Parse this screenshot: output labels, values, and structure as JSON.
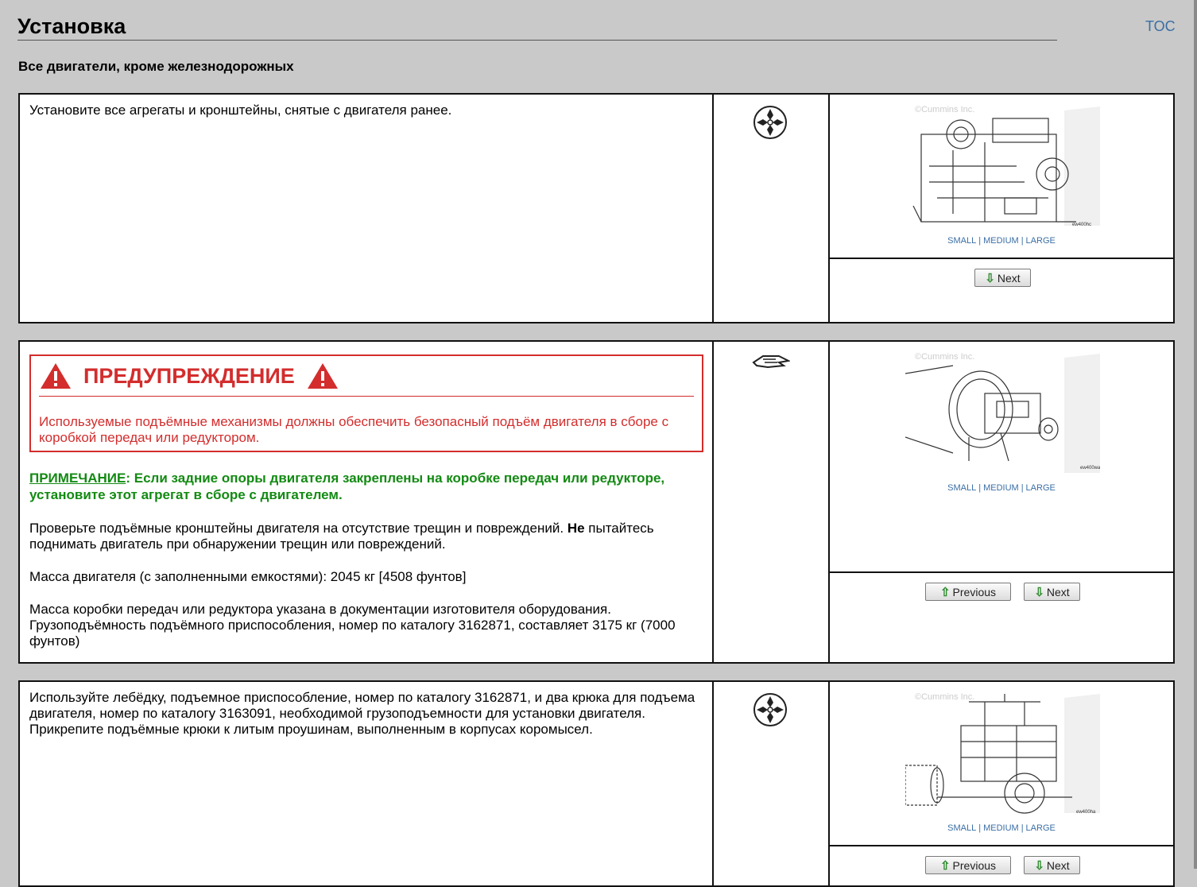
{
  "header": {
    "title": "Установка",
    "toc_label": "TOC",
    "subtitle": "Все двигатели, кроме железнодорожных"
  },
  "image_sizes": {
    "small": "SMALL",
    "medium": "MEDIUM",
    "large": "LARGE",
    "separator": "|"
  },
  "buttons": {
    "next": "Next",
    "previous": "Previous"
  },
  "steps": [
    {
      "text": "Установите все агрегаты и кронштейны, снятые с двигателя ранее.",
      "icon": "wrench-cluster-icon",
      "image_caption": "©Cummins Inc.",
      "image_code": "ew400hc"
    },
    {
      "warning": {
        "title": "ПРЕДУПРЕЖДЕНИЕ",
        "text": "Используемые подъёмные механизмы должны обеспечить безопасный подъём двигателя в сборе с коробкой передач или редуктором."
      },
      "note_label": "ПРИМЕЧАНИЕ",
      "note_text": ": Если задние опоры двигателя закреплены на коробке передач или редукторе, установите этот агрегат в сборе с двигателем.",
      "para1_a": "Проверьте подъёмные кронштейны двигателя на отсутствие трещин и повреждений. ",
      "para1_bold": "Не",
      "para1_b": " пытайтесь поднимать двигатель при обнаружении трещин или повреждений.",
      "para2": "Масса двигателя (с заполненными емкостями): 2045 кг [4508 фунтов]",
      "para3": "Масса коробки передач или редуктора указана в документации изготовителя оборудования. Грузоподъёмность подъёмного приспособления, номер по каталогу 3162871, составляет 3175 кг (7000 фунтов)",
      "icon": "hand-icon",
      "image_caption": "©Cummins Inc.",
      "image_code": "ew400wa"
    },
    {
      "text": "Используйте лебёдку, подъемное приспособление, номер по каталогу 3162871, и два крюка для подъема двигателя, номер по каталогу 3163091, необходимой грузоподъемности для установки двигателя. Прикрепите подъёмные крюки к литым проушинам, выполненным в корпусах коромысел.",
      "icon": "wrench-cluster-icon",
      "image_caption": "©Cummins Inc.",
      "image_code": "ew400ha"
    }
  ]
}
